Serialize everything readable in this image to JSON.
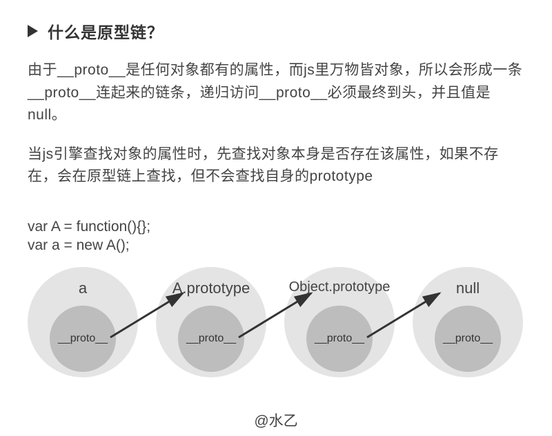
{
  "heading": "什么是原型链？",
  "para1": "由于__proto__是任何对象都有的属性，而js里万物皆对象，所以会形成一条__proto__连起来的链条，递归访问__proto__必须最终到头，并且值是 null。",
  "para2": "当js引擎查找对象的属性时，先查找对象本身是否存在该属性，如果不存在，会在原型链上查找，但不会查找自身的prototype",
  "code_line1": "var A = function(){};",
  "code_line2": "var a = new A();",
  "nodes": {
    "n0": {
      "label": "a",
      "inner": "__proto__"
    },
    "n1": {
      "label": "A.prototype",
      "inner": "__proto__"
    },
    "n2": {
      "label": "Object.prototype",
      "inner": "__proto__"
    },
    "n3": {
      "label": "null",
      "inner": "__proto__"
    }
  },
  "footer": "@水乙"
}
